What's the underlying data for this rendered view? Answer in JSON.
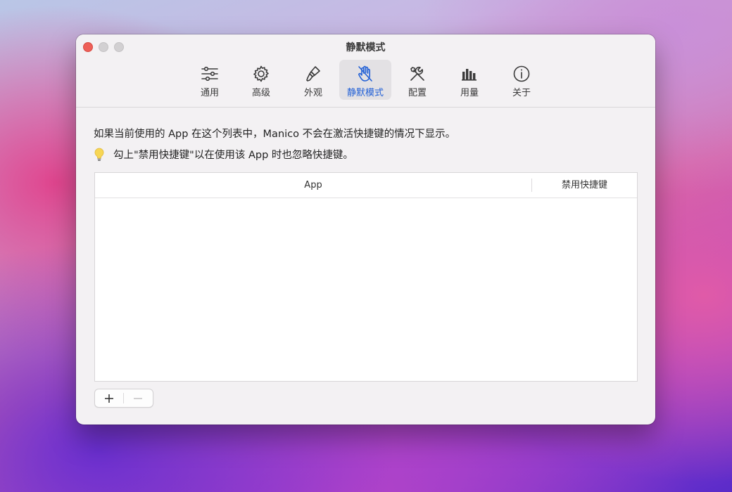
{
  "window": {
    "title": "静默模式"
  },
  "toolbar": {
    "tabs": [
      {
        "label": "通用",
        "icon": "sliders-icon"
      },
      {
        "label": "高级",
        "icon": "gear-icon"
      },
      {
        "label": "外观",
        "icon": "paintbrush-icon"
      },
      {
        "label": "静默模式",
        "icon": "hand-slash-icon",
        "active": true
      },
      {
        "label": "配置",
        "icon": "wrench-screwdriver-icon"
      },
      {
        "label": "用量",
        "icon": "bar-chart-icon"
      },
      {
        "label": "关于",
        "icon": "info-icon"
      }
    ],
    "accent_color": "#2260d6"
  },
  "content": {
    "description": "如果当前使用的 App 在这个列表中，Manico 不会在激活快捷键的情况下显示。",
    "tip": "勾上\"禁用快捷键\"以在使用该 App 时也忽略快捷键。",
    "tip_icon": "lightbulb-icon"
  },
  "table": {
    "columns": [
      "App",
      "禁用快捷键"
    ],
    "rows": []
  },
  "actions": {
    "add_label": "+",
    "remove_label": "−"
  }
}
